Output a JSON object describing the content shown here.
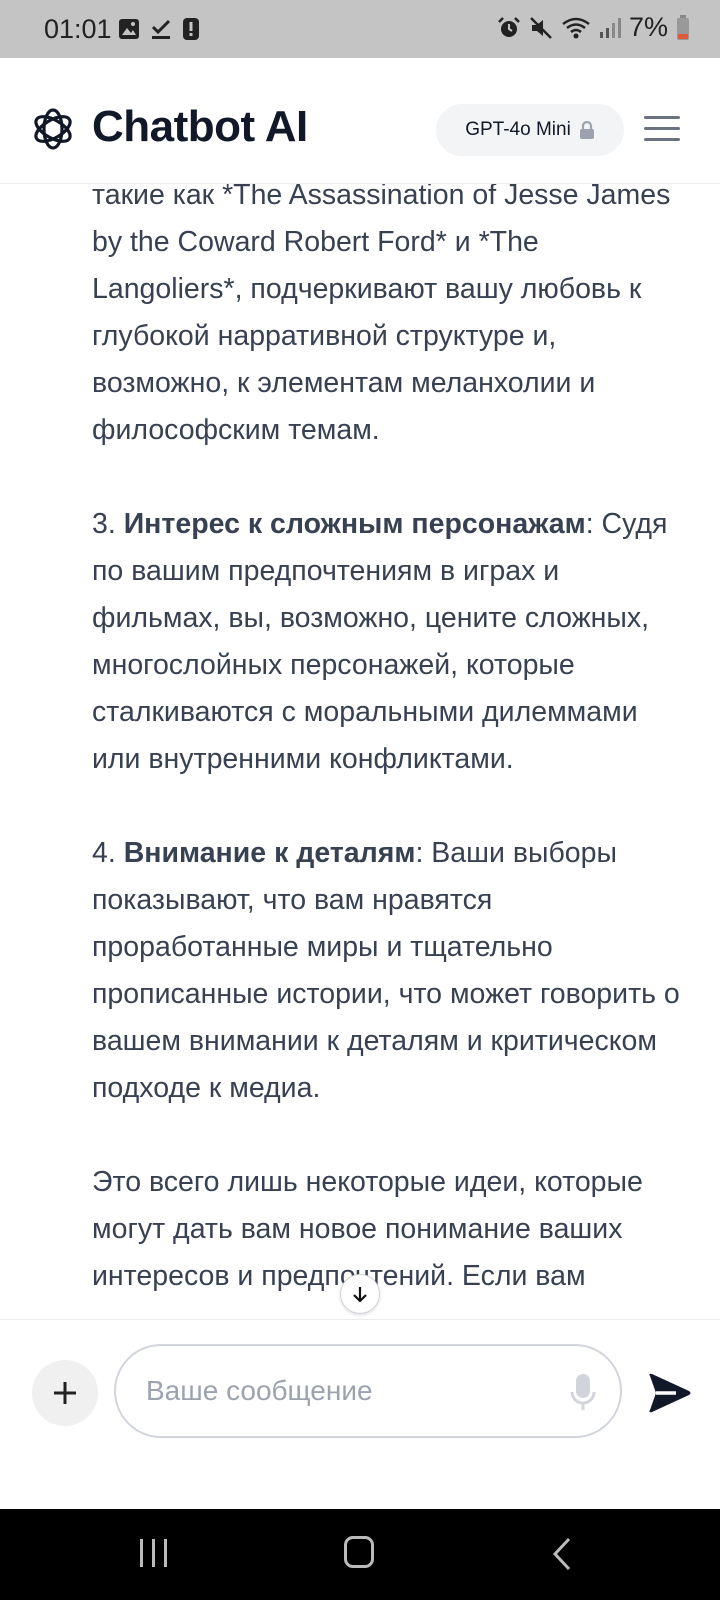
{
  "status_bar": {
    "time": "01:01",
    "battery": "7%",
    "left_icons": [
      "gallery-icon",
      "download-done-icon",
      "alert-icon"
    ],
    "right_icons": [
      "alarm-icon",
      "mute-icon",
      "wifi-icon",
      "signal-icon",
      "battery-icon"
    ]
  },
  "header": {
    "title": "Chatbot AI",
    "model": "GPT-4o Mini",
    "icons": [
      "openai-logo-icon",
      "lock-icon",
      "menu-icon"
    ]
  },
  "message": {
    "para1": "такие как *The Assassination of Jesse James by the Coward Robert Ford* и *The Langoliers*, подчеркивают вашу любовь к глубокой нарративной структуре и, возможно, к элементам меланхолии и философским темам.",
    "p3_num": "3. ",
    "p3_bold": "Интерес к сложным персонажам",
    "p3_text": ": Судя по вашим предпочтениям в играх и фильмах, вы, возможно, цените сложных, многослойных персонажей, которые сталкиваются с моральными дилеммами или внутренними конфликтами.",
    "p4_num": "4. ",
    "p4_bold": "Внимание к деталям",
    "p4_text": ": Ваши выборы показывают, что вам нравятся проработанные миры и тщательно прописанные истории, что может говорить о вашем внимании к деталям и критическом подходе к медиа.",
    "para5": "Это всего лишь некоторые идеи, которые могут дать вам новое понимание ваших интересов и предпочтений. Если вам"
  },
  "composer": {
    "placeholder": "Ваше сообщение",
    "icons": [
      "plus-icon",
      "mic-icon",
      "send-icon",
      "arrow-down-icon"
    ]
  },
  "nav_bar": {
    "icons": [
      "recents-icon",
      "home-icon",
      "back-icon"
    ]
  }
}
